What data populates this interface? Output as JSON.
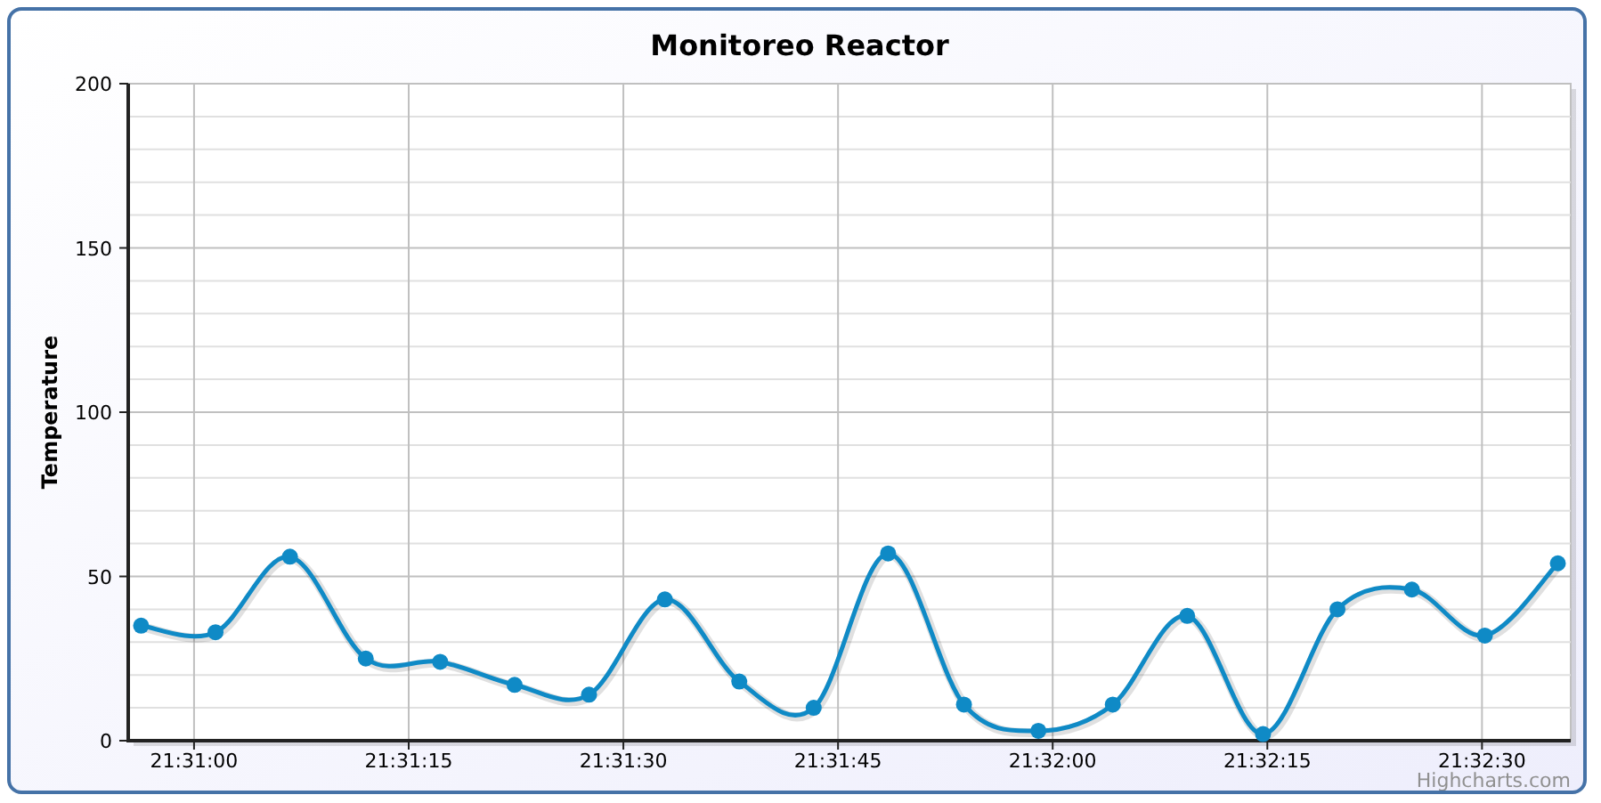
{
  "chart": {
    "chart_data": {
      "type": "line",
      "title": "Monitoreo Reactor",
      "ylabel": "Temperature",
      "x": [
        77456.3,
        77461.5,
        77466.7,
        77472.0,
        77477.2,
        77482.4,
        77487.6,
        77492.9,
        77498.1,
        77503.3,
        77508.5,
        77513.8,
        77519.0,
        77524.2,
        77529.4,
        77534.7,
        77539.9,
        77545.1,
        77550.2,
        77555.3
      ],
      "grid": true,
      "series": [
        {
          "marker": true,
          "color": "#0f8ac6",
          "values": [
            35,
            33,
            56,
            25,
            24,
            17,
            14,
            43,
            18,
            10,
            57,
            11,
            3,
            11,
            38,
            2,
            40,
            46,
            32,
            54
          ]
        }
      ],
      "xlim": [
        77455.4,
        77556.2
      ],
      "ylim": [
        0,
        200
      ],
      "xticks": [
        {
          "value": 77460,
          "label": "21:31:00"
        },
        {
          "value": 77475,
          "label": "21:31:15"
        },
        {
          "value": 77490,
          "label": "21:31:30"
        },
        {
          "value": 77505,
          "label": "21:31:45"
        },
        {
          "value": 77520,
          "label": "21:32:00"
        },
        {
          "value": 77535,
          "label": "21:32:15"
        },
        {
          "value": 77550,
          "label": "21:32:30"
        }
      ],
      "yticks": [
        0,
        50,
        100,
        150,
        200
      ]
    },
    "credit": "Highcharts.com"
  }
}
